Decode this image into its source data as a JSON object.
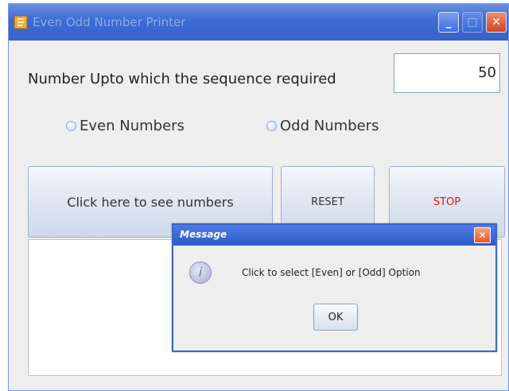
{
  "window": {
    "title": "Even Odd Number Printer",
    "minimize_glyph": "_",
    "maximize_glyph": "□",
    "close_glyph": "✕"
  },
  "form": {
    "prompt_label": "Number Upto which the sequence required",
    "number_value": "50",
    "radio_even_label": "Even Numbers",
    "radio_odd_label": "Odd Numbers"
  },
  "buttons": {
    "show_label": "Click here to see numbers",
    "reset_label": "RESET",
    "stop_label": "STOP"
  },
  "output": {
    "text": ""
  },
  "dialog": {
    "title": "Message",
    "icon_glyph": "i",
    "close_glyph": "✕",
    "message": "Click to select [Even] or [Odd] Option",
    "ok_label": "OK"
  },
  "colors": {
    "titlebar": "#3b6bd6",
    "stop_text": "#d02010",
    "dialog_border": "#3a66c8"
  }
}
